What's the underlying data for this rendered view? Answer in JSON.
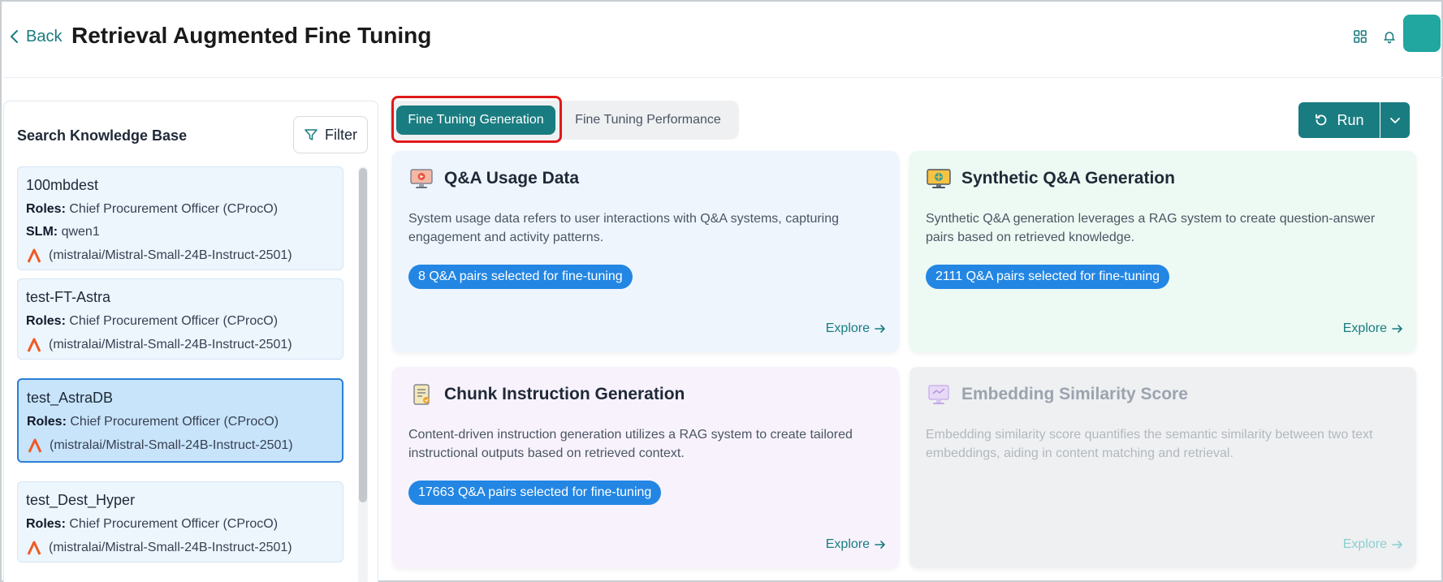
{
  "header": {
    "back_label": "Back",
    "title": "Retrieval Augmented Fine Tuning",
    "icons": [
      "grid-icon",
      "bell-icon"
    ]
  },
  "sidebar": {
    "title": "Search Knowledge Base",
    "filter_label": "Filter",
    "roles_label": "Roles:",
    "slm_label": "SLM:",
    "items": [
      {
        "name": "100mbdest",
        "roles": "Chief Procurement Officer (CProcO)",
        "slm": "qwen1",
        "model": "(mistralai/Mistral-Small-24B-Instruct-2501)"
      },
      {
        "name": "test-FT-Astra",
        "roles": "Chief Procurement Officer (CProcO)",
        "model": "(mistralai/Mistral-Small-24B-Instruct-2501)"
      },
      {
        "name": "test_AstraDB",
        "roles": "Chief Procurement Officer (CProcO)",
        "model": "(mistralai/Mistral-Small-24B-Instruct-2501)",
        "selected": true
      },
      {
        "name": "test_Dest_Hyper",
        "roles": "Chief Procurement Officer (CProcO)",
        "model": "(mistralai/Mistral-Small-24B-Instruct-2501)"
      }
    ]
  },
  "tabs": {
    "active": "Fine Tuning Generation",
    "inactive": "Fine Tuning Performance"
  },
  "run": {
    "label": "Run"
  },
  "cards": [
    {
      "title": "Q&A Usage Data",
      "description": "System usage data refers to user interactions with Q&A systems, capturing engagement and activity patterns.",
      "badge": "8 Q&A pairs selected for fine-tuning",
      "explore": "Explore"
    },
    {
      "title": "Synthetic Q&A Generation",
      "description": "Synthetic Q&A generation leverages a RAG system to create question-answer pairs based on retrieved knowledge.",
      "badge": "2111 Q&A pairs selected for fine-tuning",
      "explore": "Explore"
    },
    {
      "title": "Chunk Instruction Generation",
      "description": "Content-driven instruction generation utilizes a RAG system to create tailored instructional outputs based on retrieved context.",
      "badge": "17663 Q&A pairs selected for fine-tuning",
      "explore": "Explore"
    },
    {
      "title": "Embedding Similarity Score",
      "description": "Embedding similarity score quantifies the semantic similarity between two text embeddings, aiding in content matching and retrieval.",
      "explore": "Explore",
      "disabled": true
    }
  ],
  "colors": {
    "accent": "#197c80",
    "badge": "#2386e3",
    "highlight": "#e01919"
  }
}
